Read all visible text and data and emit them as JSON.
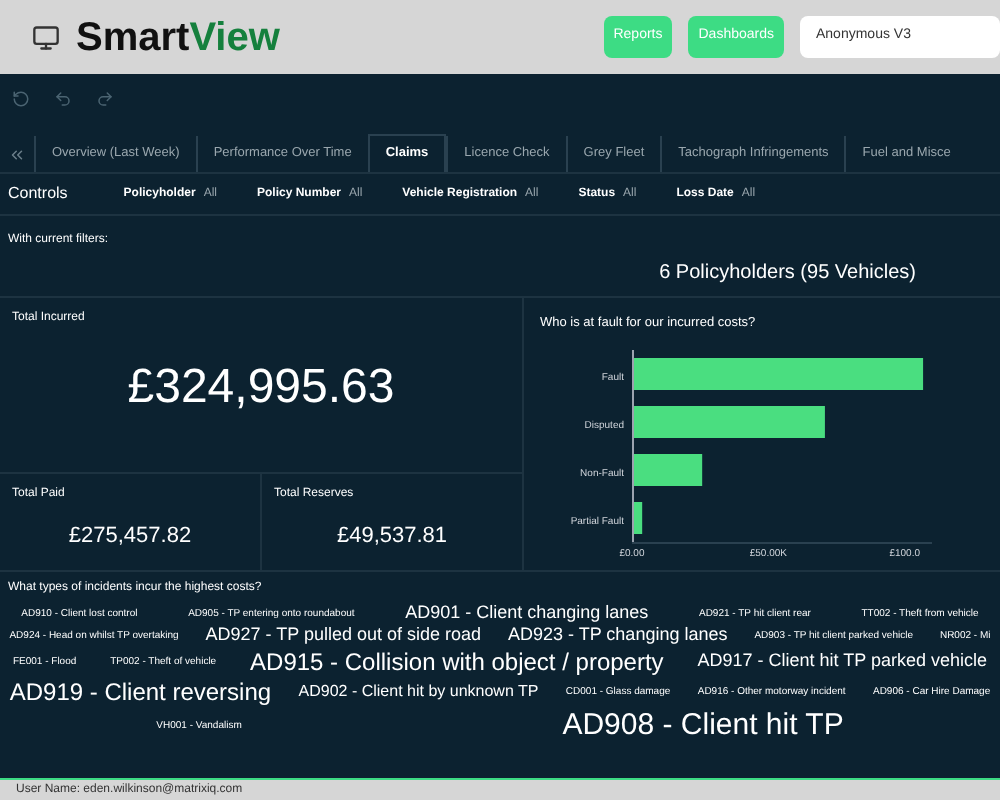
{
  "header": {
    "logo_prefix": "Smart",
    "logo_suffix": "View",
    "buttons": [
      "Reports",
      "Dashboards"
    ],
    "account": {
      "value": "Anonymous V3"
    }
  },
  "tabs": [
    {
      "label": "Overview (Last Week)",
      "selected": false
    },
    {
      "label": "Performance Over Time",
      "selected": false
    },
    {
      "label": "Claims",
      "selected": true
    },
    {
      "label": "Licence Check",
      "selected": false
    },
    {
      "label": "Grey Fleet",
      "selected": false
    },
    {
      "label": "Tachograph Infringements",
      "selected": false
    },
    {
      "label": "Fuel and Misce",
      "selected": false
    }
  ],
  "controls": {
    "title": "Controls",
    "filters": [
      {
        "label": "Policyholder",
        "value": "All"
      },
      {
        "label": "Policy Number",
        "value": "All"
      },
      {
        "label": "Vehicle Registration",
        "value": "All"
      },
      {
        "label": "Status",
        "value": "All"
      },
      {
        "label": "Loss Date",
        "value": "All"
      }
    ]
  },
  "summary": {
    "caption": "With current filters:",
    "count": "6 Policyholders (95 Vehicles)"
  },
  "total_incurred": {
    "title": "Total Incurred",
    "value": "£324,995.63"
  },
  "total_paid": {
    "title": "Total Paid",
    "value": "£275,457.82"
  },
  "total_reserves": {
    "title": "Total Reserves",
    "value": "£49,537.81"
  },
  "fault_chart": {
    "title": "Who is at fault for our incurred costs?",
    "chart_data": {
      "type": "bar",
      "orientation": "horizontal",
      "categories": [
        "Fault",
        "Disputed",
        "Non-Fault",
        "Partial Fault"
      ],
      "series": [
        {
          "color": "#4ade80",
          "values": [
            106,
            70,
            25,
            3
          ]
        }
      ],
      "xlim": [
        0,
        110
      ],
      "xticks": [
        {
          "value": 0,
          "label": "£0.00"
        },
        {
          "value": 50,
          "label": "£50.00K"
        },
        {
          "value": 100,
          "label": "£100.0"
        }
      ]
    }
  },
  "word_cloud": {
    "title": "What types of incidents incur the highest costs?",
    "words": [
      {
        "text": "AD910 - Client lost control",
        "kind": "tiny"
      },
      {
        "text": "AD905 - TP entering onto roundabout",
        "kind": "tiny"
      },
      {
        "text": "AD901 - Client changing lanes",
        "kind": "medium"
      },
      {
        "text": "AD921 - TP hit client rear",
        "kind": "tiny"
      },
      {
        "text": "TT002 - Theft from vehicle",
        "kind": "tiny"
      },
      {
        "text": "AD924 - Head on whilst TP overtaking",
        "kind": "tiny"
      },
      {
        "text": "AD927 - TP pulled out of side road",
        "kind": "medium"
      },
      {
        "text": "AD923 - TP changing lanes",
        "kind": "medium"
      },
      {
        "text": "AD903 - TP hit client parked vehicle",
        "kind": "tiny"
      },
      {
        "text": "NR002 - Mi",
        "kind": "tiny"
      },
      {
        "text": "FE001 - Flood",
        "kind": "tiny"
      },
      {
        "text": "TP002 - Theft of vehicle",
        "kind": "tiny"
      },
      {
        "text": "AD915 - Collision with object / property",
        "kind": "large"
      },
      {
        "text": "AD917 - Client hit TP parked vehicle",
        "kind": "medium"
      },
      {
        "text": "AD919 - Client reversing",
        "kind": "large"
      },
      {
        "text": "AD902 - Client hit by unknown TP",
        "kind": "small"
      },
      {
        "text": "CD001 - Glass damage",
        "kind": "tiny"
      },
      {
        "text": "AD916 - Other motorway incident",
        "kind": "tiny"
      },
      {
        "text": "AD906 - Car Hire Damage",
        "kind": "tiny"
      },
      {
        "text": "VH001 - Vandalism",
        "kind": "tiny"
      },
      {
        "text": "AD908 - Client hit TP",
        "kind": "huge"
      }
    ]
  },
  "status_bar": {
    "user": "User Name: eden.wilkinson@matrixiq.com"
  }
}
